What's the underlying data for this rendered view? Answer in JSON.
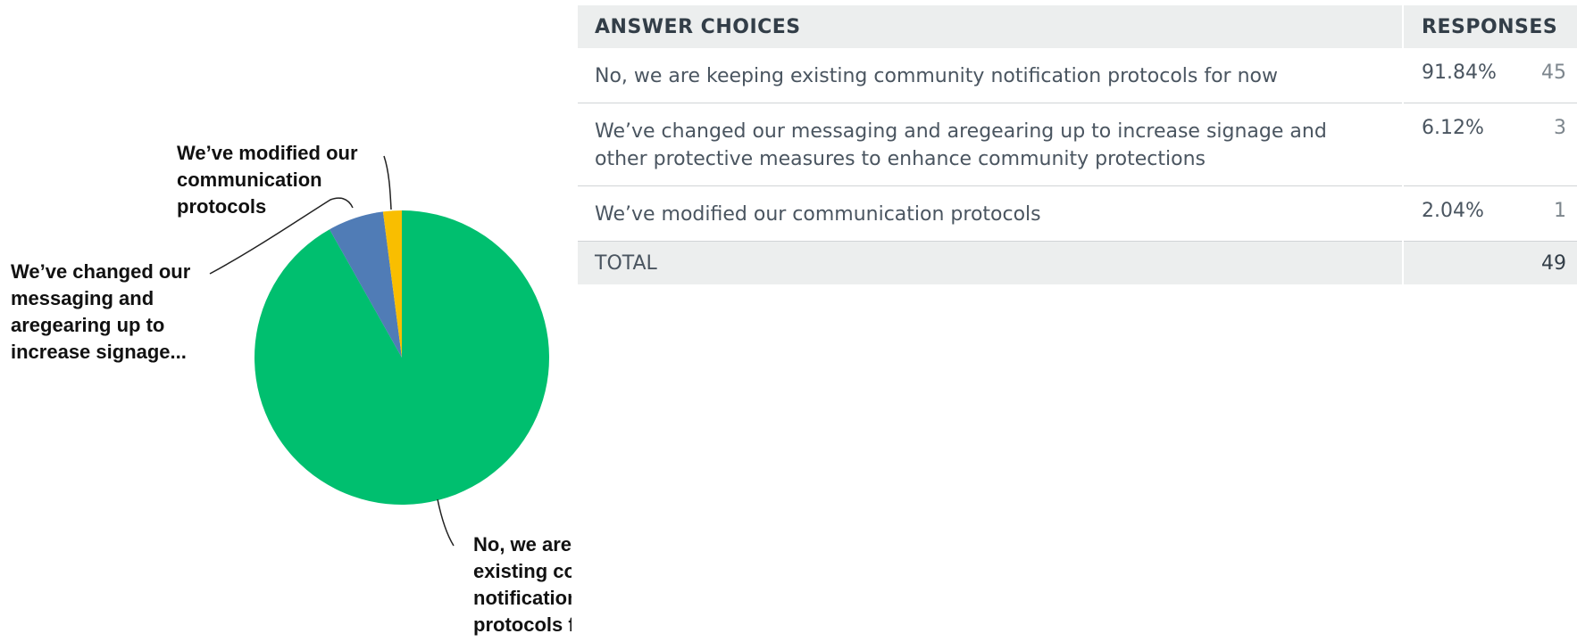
{
  "chart_data": {
    "type": "pie",
    "slices": [
      {
        "label": "No, we are keeping existing community notification protocols for now",
        "percent": 91.84,
        "count": 45,
        "color": "#00bf6f"
      },
      {
        "label": "We’ve changed our messaging and aregearing up to increase signage...",
        "percent": 6.12,
        "count": 3,
        "color": "#507cb6"
      },
      {
        "label": "We’ve modified our communication protocols",
        "percent": 2.04,
        "count": 1,
        "color": "#f9be00"
      }
    ],
    "callouts": [
      [
        "No, we are keeping",
        "existing community",
        "notification",
        "protocols for now"
      ],
      [
        "We’ve changed our",
        "messaging and",
        "aregearing up to",
        "increase signage..."
      ],
      [
        "We’ve modified our",
        "communication",
        "protocols"
      ]
    ]
  },
  "table": {
    "headers": {
      "choices": "ANSWER CHOICES",
      "responses": "RESPONSES"
    },
    "rows": [
      {
        "choice": "No, we are keeping existing community notification protocols for now",
        "percent": "91.84%",
        "count": "45"
      },
      {
        "choice": "We’ve changed our messaging and aregearing up to increase signage and other protective measures to enhance community protections",
        "percent": "6.12%",
        "count": "3"
      },
      {
        "choice": "We’ve modified our communication protocols",
        "percent": "2.04%",
        "count": "1"
      }
    ],
    "total": {
      "label": "TOTAL",
      "count": "49"
    }
  }
}
